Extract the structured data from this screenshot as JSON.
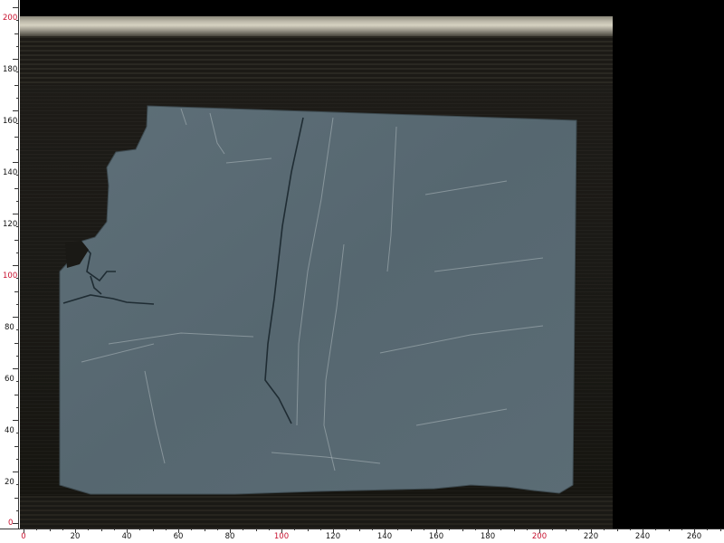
{
  "image": {
    "subject": "stone-slab-scan",
    "colors": {
      "slab": "#5a6b74",
      "slab_light": "#6c7c85",
      "vein": "#b9c4c8",
      "crack": "#1f2c33",
      "background": "#000000",
      "highlight": "#c8102e"
    }
  },
  "ruler": {
    "vertical": [
      "0",
      "20",
      "40",
      "60",
      "80",
      "100",
      "120",
      "140",
      "160",
      "180",
      "200"
    ],
    "horizontal": [
      "0",
      "20",
      "40",
      "60",
      "80",
      "100",
      "120",
      "140",
      "160",
      "180",
      "200",
      "220",
      "240",
      "260"
    ],
    "highlighted": [
      "0",
      "100",
      "200"
    ]
  }
}
